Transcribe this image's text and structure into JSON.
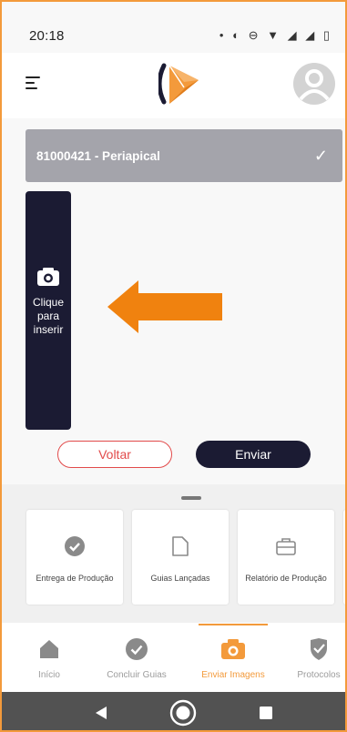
{
  "status_bar": {
    "time": "20:18",
    "icons": [
      "dot",
      "vibrate-icon",
      "dnd-icon",
      "wifi-icon",
      "signal-icon",
      "signal-icon",
      "battery-icon"
    ]
  },
  "header": {
    "menu_icon": "hamburger-icon",
    "logo": "brand-logo",
    "avatar_icon": "user-avatar-icon"
  },
  "guide": {
    "label": "81000421 - Periapical",
    "status_icon": "check-icon"
  },
  "upload": {
    "icon": "camera-icon",
    "text_lines": [
      "Clique",
      "para",
      "inserir"
    ]
  },
  "actions": {
    "back_label": "Voltar",
    "send_label": "Enviar"
  },
  "shortcuts": [
    {
      "label": "Entrega de Produção",
      "icon": "check-circle-icon"
    },
    {
      "label": "Guias Lançadas",
      "icon": "document-icon"
    },
    {
      "label": "Relatório de Produção",
      "icon": "briefcase-icon"
    }
  ],
  "bottom_nav": [
    {
      "label": "Início",
      "icon": "home-icon"
    },
    {
      "label": "Concluir Guias",
      "icon": "check-circle-icon"
    },
    {
      "label": "Enviar Imagens",
      "icon": "camera-icon",
      "active": true
    },
    {
      "label": "Protocolos",
      "icon": "shield-check-icon"
    }
  ],
  "colors": {
    "accent": "#F39A3B",
    "dark": "#1b1b33",
    "guide_bar": "#a4a4ab",
    "danger": "#e24b4b"
  }
}
